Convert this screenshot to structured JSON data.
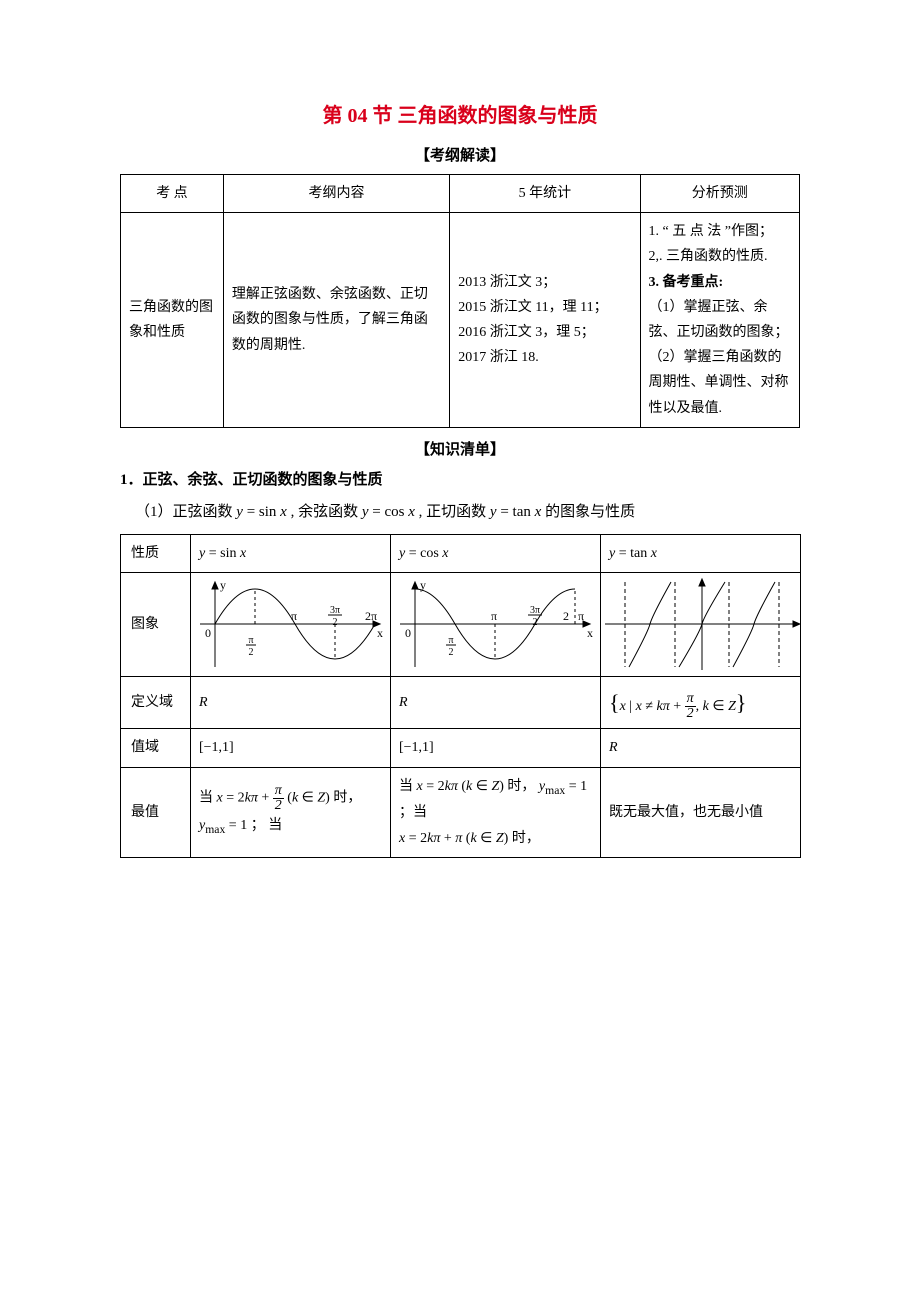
{
  "title": "第 04 节   三角函数的图象与性质",
  "sections": {
    "kgjd": "【考纲解读】",
    "zsqd": "【知识清单】"
  },
  "table1": {
    "headers": [
      "考  点",
      "考纲内容",
      "5 年统计",
      "分析预测"
    ],
    "row": {
      "kp": "三角函数的图象和性质",
      "content": "理解正弦函数、余弦函数、正切函数的图象与性质，了解三角函数的周期性.",
      "stats": [
        "2013 浙江文 3；",
        "2015 浙江文 11，理 11；",
        "2016 浙江文 3，理 5；",
        "2017 浙江 18."
      ],
      "analysis": {
        "l1": "1. “ 五 点 法 ”作图；",
        "l2": "2,. 三角函数的性质.",
        "l3": "3. 备考重点:",
        "l4": "（1）掌握正弦、余弦、正切函数的图象；",
        "l5": "（2）掌握三角函数的周期性、单调性、对称性以及最值."
      }
    }
  },
  "heading2": "1．正弦、余弦、正切函数的图象与性质",
  "subline": "（1）正弦函数 y = sin x , 余弦函数 y = cos x , 正切函数 y = tan x 的图象与性质",
  "table2": {
    "rowlabels": {
      "prop": "性质",
      "graph": "图象",
      "domain": "定义域",
      "range": "值域",
      "extreme": "最值"
    },
    "head": {
      "sin": "y = sin x",
      "cos": "y = cos x",
      "tan": "y = tan x"
    },
    "domain": {
      "sin": "R",
      "cos": "R",
      "tan_pre": "x | x ≠ kπ +",
      "tan_post": ", k ∈ Z"
    },
    "range": {
      "sin": "[−1,1]",
      "cos": "[−1,1]",
      "tan": "R"
    },
    "extreme": {
      "sin_1a": "当",
      "sin_1b": "x = 2kπ +",
      "sin_1c": "(k ∈ Z)",
      "sin_1d": "时，",
      "sin_2": "y",
      "sin_2b": "max",
      "sin_2c": " = 1 ； 当",
      "cos_1": "当 x = 2kπ (k ∈ Z) 时，  y",
      "cos_1b": "max",
      "cos_1c": " = 1 ；当",
      "cos_2": "x = 2kπ + π (k ∈ Z) 时，",
      "tan": "既无最大值，也无最小值"
    }
  },
  "graph_labels": {
    "pi": "π",
    "twopi": "2π",
    "halfpi_num": "π",
    "halfpi_den": "2",
    "threehalfpi_num": "3π",
    "threehalfpi_den": "2",
    "origin": "0",
    "x": "x",
    "y": "y"
  }
}
